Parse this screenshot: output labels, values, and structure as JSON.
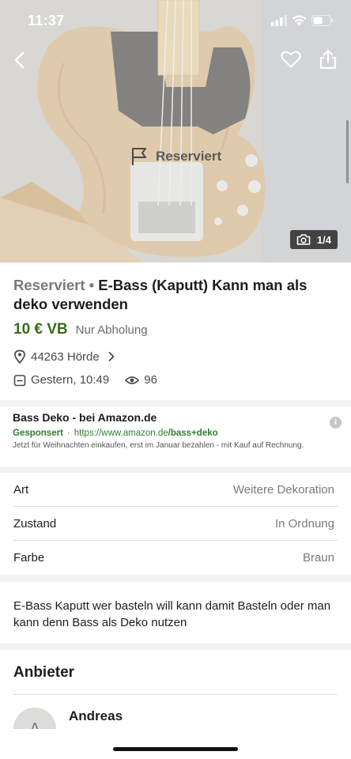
{
  "status_bar": {
    "time": "11:37"
  },
  "hero": {
    "reserved_label": "Reserviert",
    "photo_counter": "1/4"
  },
  "listing": {
    "status": "Reserviert",
    "separator": "•",
    "title": "E-Bass (Kaputt) Kann man als deko verwenden",
    "price": "10 € VB",
    "pickup": "Nur Abholung",
    "location": "44263 Hörde",
    "date": "Gestern, 10:49",
    "views": "96"
  },
  "ad": {
    "title": "Bass Deko - bei Amazon.de",
    "sponsored": "Gesponsert",
    "dot": "·",
    "url_prefix": "https://www.amazon.de",
    "url_bold": "/bass+deko",
    "description": "Jetzt für Weihnachten einkaufen, erst im Januar bezahlen - mit Kauf auf Rechnung.",
    "info_glyph": "i"
  },
  "details": [
    {
      "key": "Art",
      "value": "Weitere Dekoration"
    },
    {
      "key": "Zustand",
      "value": "In Ordnung"
    },
    {
      "key": "Farbe",
      "value": "Braun"
    }
  ],
  "description": "E-Bass Kaputt wer basteln will kann damit Basteln oder man kann denn Bass als Deko nutzen",
  "seller": {
    "heading": "Anbieter",
    "name": "Andreas",
    "initial": "A"
  },
  "colors": {
    "price_green": "#3a6b1c",
    "sponsor_green": "#2e7d32"
  }
}
